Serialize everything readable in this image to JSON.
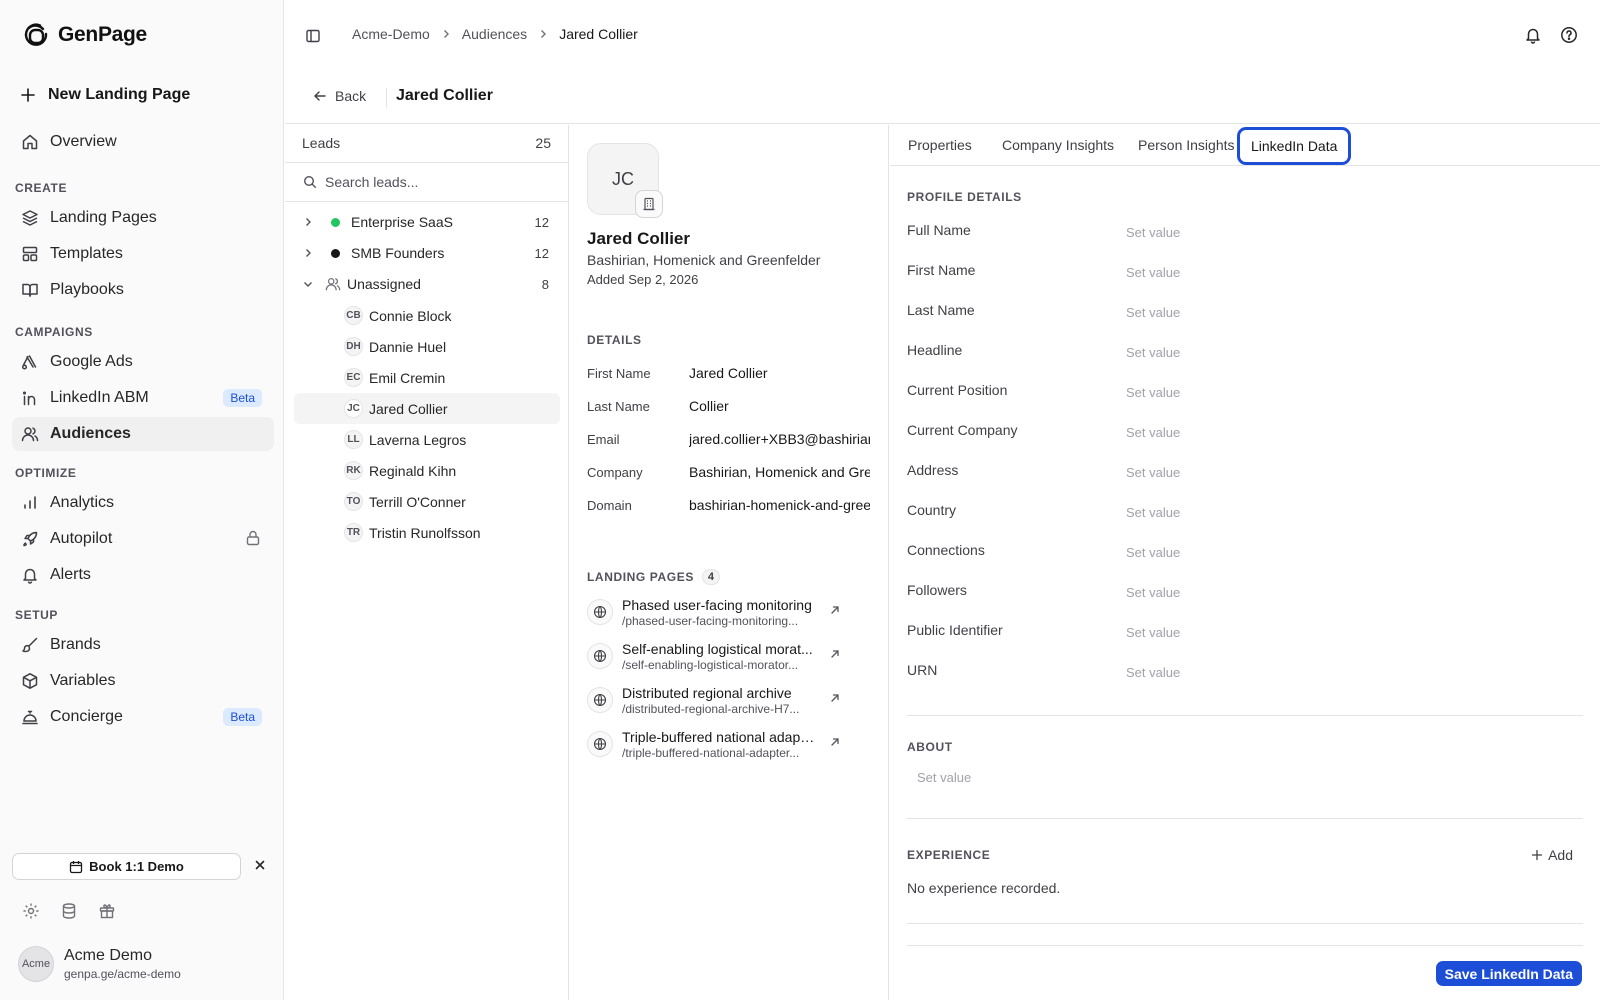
{
  "app": {
    "name": "GenPage"
  },
  "sidebar": {
    "new_landing_page": "New Landing Page",
    "overview": "Overview",
    "sections": {
      "create": "CREATE",
      "campaigns": "CAMPAIGNS",
      "optimize": "OPTIMIZE",
      "setup": "SETUP"
    },
    "items": {
      "landing_pages": "Landing Pages",
      "templates": "Templates",
      "playbooks": "Playbooks",
      "google_ads": "Google Ads",
      "linkedin_abm": "LinkedIn ABM",
      "audiences": "Audiences",
      "analytics": "Analytics",
      "autopilot": "Autopilot",
      "alerts": "Alerts",
      "brands": "Brands",
      "variables": "Variables",
      "concierge": "Concierge"
    },
    "beta_label": "Beta",
    "book_demo": "Book 1:1 Demo",
    "account": {
      "avatar_alt": "Acme",
      "name": "Acme Demo",
      "url": "genpa.ge/acme-demo"
    }
  },
  "breadcrumb": [
    "Acme-Demo",
    "Audiences",
    "Jared Collier"
  ],
  "header": {
    "back": "Back",
    "title": "Jared Collier"
  },
  "leads": {
    "title": "Leads",
    "count": "25",
    "search_placeholder": "Search leads...",
    "groups": [
      {
        "name": "Enterprise SaaS",
        "count": "12",
        "color": "#22c55e"
      },
      {
        "name": "SMB Founders",
        "count": "12",
        "color": "#18181b"
      },
      {
        "name": "Unassigned",
        "count": "8"
      }
    ],
    "items": [
      {
        "initials": "CB",
        "name": "Connie Block"
      },
      {
        "initials": "DH",
        "name": "Dannie Huel"
      },
      {
        "initials": "EC",
        "name": "Emil Cremin"
      },
      {
        "initials": "JC",
        "name": "Jared Collier"
      },
      {
        "initials": "LL",
        "name": "Laverna Legros"
      },
      {
        "initials": "RK",
        "name": "Reginald Kihn"
      },
      {
        "initials": "TO",
        "name": "Terrill O'Conner"
      },
      {
        "initials": "TR",
        "name": "Tristin Runolfsson"
      }
    ]
  },
  "detail": {
    "initials": "JC",
    "name": "Jared Collier",
    "company": "Bashirian, Homenick and Greenfelder",
    "added": "Added Sep 2, 2026",
    "details_title": "DETAILS",
    "fields": [
      {
        "label": "First Name",
        "value": "Jared Collier"
      },
      {
        "label": "Last Name",
        "value": "Collier"
      },
      {
        "label": "Email",
        "value": "jared.collier+XBB3@bashirian"
      },
      {
        "label": "Company",
        "value": "Bashirian, Homenick and Gree"
      },
      {
        "label": "Domain",
        "value": "bashirian-homenick-and-gree"
      }
    ],
    "landing_pages_title": "LANDING PAGES",
    "landing_pages_count": "4",
    "landing_pages": [
      {
        "title": "Phased user-facing monitoring",
        "slug": "/phased-user-facing-monitoring..."
      },
      {
        "title": "Self-enabling logistical morat...",
        "slug": "/self-enabling-logistical-morator..."
      },
      {
        "title": "Distributed regional archive",
        "slug": "/distributed-regional-archive-H7..."
      },
      {
        "title": "Triple-buffered national adapter",
        "slug": "/triple-buffered-national-adapter..."
      }
    ]
  },
  "tabs": [
    "Properties",
    "Company Insights",
    "Person Insights",
    "LinkedIn Data"
  ],
  "linkedin": {
    "profile_title": "PROFILE DETAILS",
    "placeholder": "Set value",
    "fields": [
      "Full Name",
      "First Name",
      "Last Name",
      "Headline",
      "Current Position",
      "Current Company",
      "Address",
      "Country",
      "Connections",
      "Followers",
      "Public Identifier",
      "URN"
    ],
    "about_title": "ABOUT",
    "experience_title": "EXPERIENCE",
    "add_label": "Add",
    "no_experience": "No experience recorded.",
    "save_label": "Save LinkedIn Data"
  },
  "colors": {
    "accent": "#1d4ed8",
    "beta_bg": "#dbeafe"
  }
}
